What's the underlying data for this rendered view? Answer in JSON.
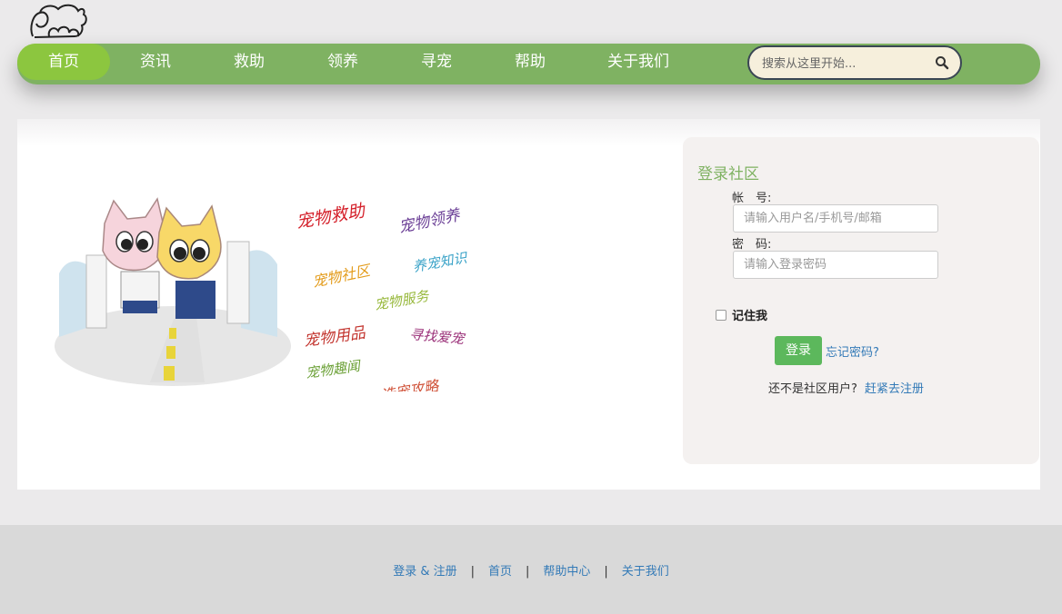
{
  "nav": {
    "items": [
      {
        "label": "首页",
        "active": true
      },
      {
        "label": "资讯"
      },
      {
        "label": "救助"
      },
      {
        "label": "领养"
      },
      {
        "label": "寻宠"
      },
      {
        "label": "帮助"
      },
      {
        "label": "关于我们"
      }
    ],
    "search": {
      "placeholder": "搜索从这里开始..."
    }
  },
  "illustration": {
    "words": [
      "宠物救助",
      "宠物领养",
      "宠物社区",
      "养宠知识",
      "宠物服务",
      "宠物用品",
      "寻找爱宠",
      "宠物趣闻",
      "选宠攻略"
    ]
  },
  "login": {
    "title": "登录社区",
    "account_label": "帐　号:",
    "account_placeholder": "请输入用户名/手机号/邮箱",
    "password_label": "密　码:",
    "password_placeholder": "请输入登录密码",
    "remember_label": "记住我",
    "login_button": "登录",
    "forgot_link": "忘记密码?",
    "register_text": "还不是社区用户?",
    "register_link": "赶紧去注册"
  },
  "footer": {
    "links": [
      "登录 & 注册",
      "首页",
      "帮助中心",
      "关于我们"
    ],
    "separator": "|"
  },
  "colors": {
    "nav_bg": "#7fb262",
    "nav_active": "#8cc63f",
    "login_button": "#5cb85c",
    "link": "#337ab7",
    "title_green": "#7fb262"
  }
}
